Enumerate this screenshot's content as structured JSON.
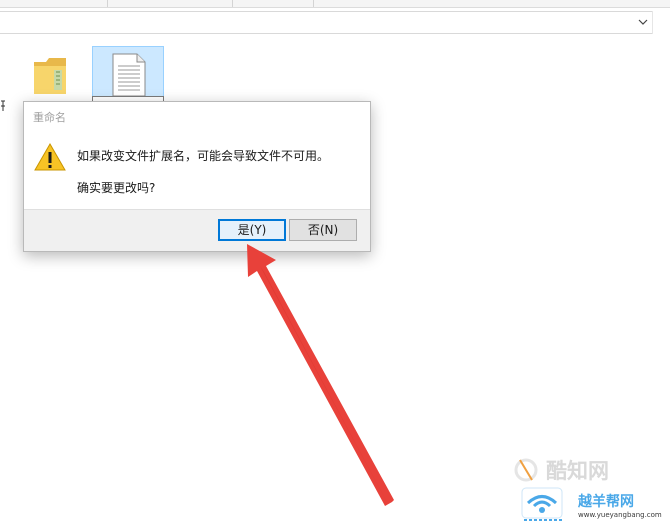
{
  "dialog": {
    "title": "重命名",
    "message_line1": "如果改变文件扩展名，可能会导致文件不可用。",
    "message_line2": "确实要更改吗?",
    "yes_label": "是(Y)",
    "no_label": "否(N)"
  },
  "watermark": {
    "brand_cn": "酷知网",
    "brand_cn2": "越羊帮网",
    "url": "www.yueyangbang.com"
  },
  "colors": {
    "accent": "#0078d7",
    "arrow": "#e8413a",
    "selection": "#cce8ff"
  }
}
